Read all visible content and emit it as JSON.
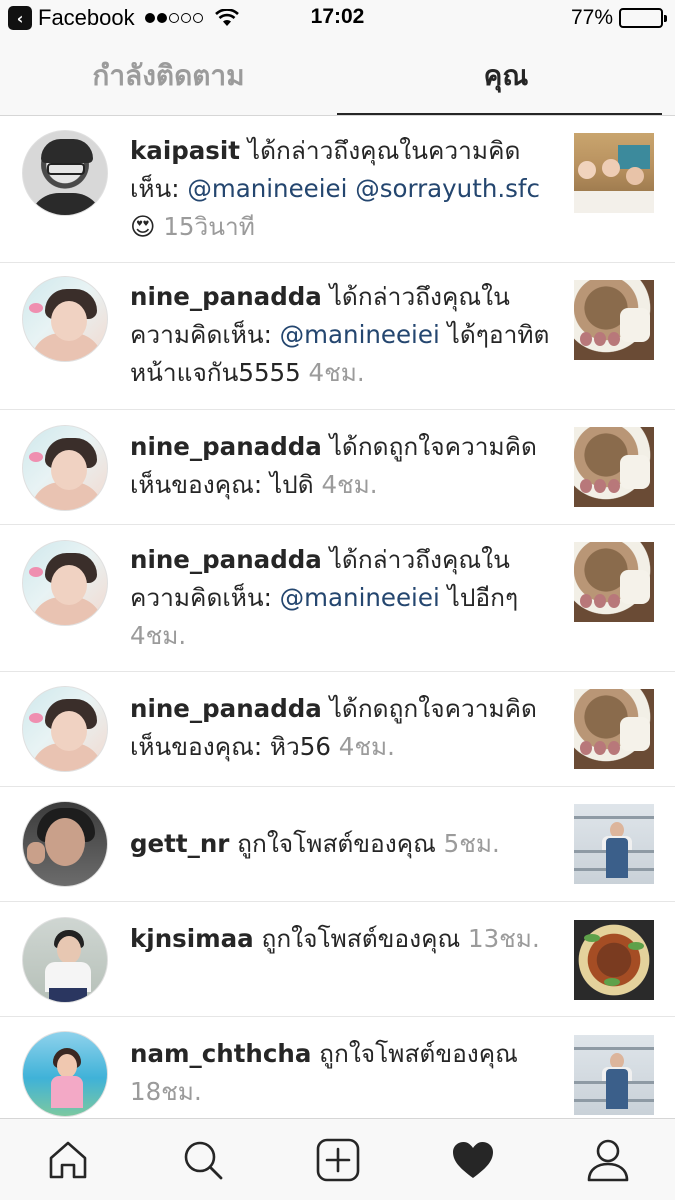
{
  "status_bar": {
    "back_app": "Facebook",
    "time": "17:02",
    "battery": "77%",
    "battery_level": 0.77,
    "signal_bars": 2
  },
  "tabs": {
    "following": "กำลังติดตาม",
    "you": "คุณ",
    "active": "you"
  },
  "notifications": [
    {
      "username": "kaipasit",
      "text": " ได้กล่าวถึงคุณในความคิดเห็น: ",
      "mentions": [
        "@manineeiei",
        "@sorrayuth.sfc"
      ],
      "emoji": "😍",
      "after_text": "",
      "time": "15วินาที"
    },
    {
      "username": "nine_panadda",
      "text": " ได้กล่าวถึงคุณในความคิดเห็น: ",
      "mention": "@manineeiei",
      "after_text": " ได้ๆอาทิตหน้าแจกัน5555 ",
      "time": "4ชม."
    },
    {
      "username": "nine_panadda",
      "text": " ได้กดถูกใจความคิดเห็นของคุณ: ไปดิ ",
      "time": "4ชม."
    },
    {
      "username": "nine_panadda",
      "text": " ได้กล่าวถึงคุณในความคิดเห็น: ",
      "mention": "@manineeiei",
      "after_text": " ไปอีกๆ ",
      "time": "4ชม."
    },
    {
      "username": "nine_panadda",
      "text": " ได้กดถูกใจความคิดเห็นของคุณ: หิว56 ",
      "time": "4ชม."
    },
    {
      "username": "gett_nr",
      "text": " ถูกใจโพสต์ของคุณ ",
      "time": "5ชม."
    },
    {
      "username": "kjnsimaa",
      "text": " ถูกใจโพสต์ของคุณ ",
      "time": "13ชม."
    },
    {
      "username": "nam_chthcha",
      "text": " ถูกใจโพสต์ของคุณ ",
      "time": "18ชม."
    }
  ],
  "bottom_nav": [
    "home-icon",
    "search-icon",
    "add-post-icon",
    "activity-heart-icon",
    "profile-icon"
  ],
  "colors": {
    "mention": "#24466f",
    "timestamp": "#9b9b9b",
    "text": "#262626",
    "bar_bg": "#f8f8f8"
  }
}
